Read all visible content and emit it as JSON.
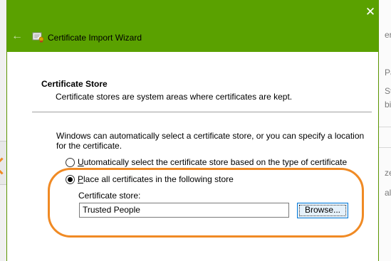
{
  "dialog": {
    "title": "Certificate Import Wizard",
    "section_heading": "Certificate Store",
    "section_description": "Certificate stores are system areas where certificates are kept.",
    "intro_text": "Windows can automatically select a certificate store, or you can specify a location for the certificate.",
    "options": [
      {
        "label": "Automatically select the certificate store based on the type of certificate",
        "mnemonic": "U",
        "selected": false
      },
      {
        "label": "Place all certificates in the following store",
        "mnemonic": "P",
        "selected": true
      }
    ],
    "store_label": "Certificate store:",
    "store_value": "Trusted People",
    "browse_label": "Browse...",
    "icons": {
      "close": "close-icon",
      "back": "back-arrow-icon",
      "app": "certificate-icon"
    }
  },
  "background": {
    "fragments": [
      "er",
      "Pa",
      "St",
      "bi",
      "ze",
      "al"
    ]
  },
  "colors": {
    "titlebar": "#5aa100",
    "highlight": "#f08a24",
    "button_border": "#0078d7",
    "button_fill": "#e5f1fb"
  }
}
